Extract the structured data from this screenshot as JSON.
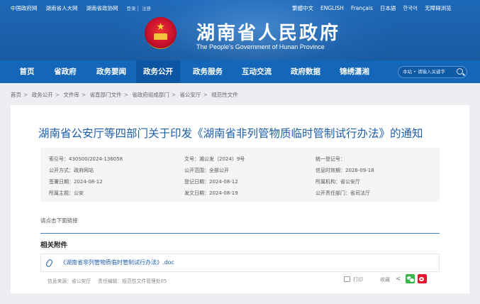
{
  "top_links": [
    "中国政府网",
    "湖南省人大网",
    "湖南省政协网"
  ],
  "account": {
    "login": "登录",
    "sep": "|",
    "register": "注册"
  },
  "languages": [
    "繁體中文",
    "ENGLISH",
    "Français",
    "日本語",
    "한국어",
    "无障碍浏览"
  ],
  "site": {
    "title": "湖南省人民政府",
    "subtitle": "The People's Government of Hunan Province"
  },
  "nav": [
    {
      "label": "首页"
    },
    {
      "label": "省政府"
    },
    {
      "label": "政务要闻"
    },
    {
      "label": "政务公开",
      "active": true
    },
    {
      "label": "政务服务"
    },
    {
      "label": "互动交流"
    },
    {
      "label": "政府数据"
    },
    {
      "label": "锦绣潇湘"
    }
  ],
  "search": {
    "placeholder": "本站 • 请输入关键字"
  },
  "breadcrumb": [
    "首页",
    "政务公开",
    "文件库",
    "省直部门文件",
    "省政府组成部门",
    "省公安厅",
    "规范性文件"
  ],
  "article": {
    "title": "湖南省公安厅等四部门关于印发《湖南省非列管物质临时管制试行办法》的通知",
    "meta": [
      [
        "索引号：430S00/2024-136058",
        "文号：湘公发〔2024〕9号",
        "统一登记号："
      ],
      [
        "公开方式：政府网站",
        "公开范围：全部公开",
        "信息时效期：2026-09-18"
      ],
      [
        "签署日期：2024-08-12",
        "登记日期：2024-08-12",
        "所属机构：省公安厅"
      ],
      [
        "所属主题：公安",
        "发文日期：2024-08-19",
        "公开责任部门：省司法厅"
      ]
    ],
    "notice": "请点击下面链接",
    "attachments_heading": "相关附件",
    "attachment": "《湖南省非列管物质临时管制试行办法》.doc",
    "source": "信息来源：省公安厅",
    "editor": "责任编辑：规范性文件管理处05",
    "print": "打印",
    "favorite": "收藏"
  },
  "colors": {
    "header": "#1d69b8",
    "nav": "#1467b8",
    "title": "#1d5ea8",
    "wechat": "#3bb44a",
    "weibo": "#e6162d"
  }
}
